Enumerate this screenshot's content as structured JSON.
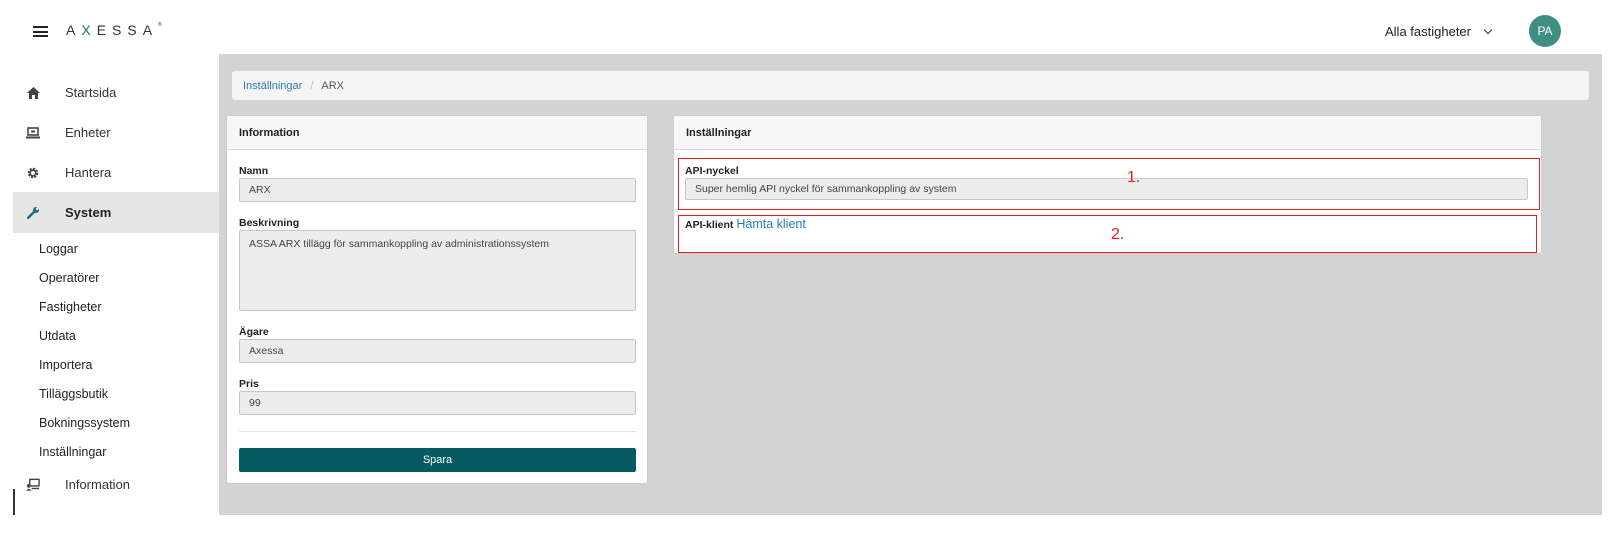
{
  "header": {
    "logo": {
      "pre": "A",
      "x": "X",
      "post": "ESSA",
      "mark": "®"
    },
    "property_select": "Alla fastigheter",
    "avatar_initials": "PA",
    "accent": "#3e8e83"
  },
  "sidebar": {
    "main_items": [
      {
        "label": "Startsida",
        "icon": "home-icon"
      },
      {
        "label": "Enheter",
        "icon": "laptop-icon"
      },
      {
        "label": "Hantera",
        "icon": "gear-icon"
      },
      {
        "label": "System",
        "icon": "wrench-icon",
        "active": true
      }
    ],
    "sub_items": [
      "Loggar",
      "Operatörer",
      "Fastigheter",
      "Utdata",
      "Importera",
      "Tilläggsbutik",
      "Bokningssystem",
      "Inställningar"
    ],
    "info_item": {
      "label": "Information",
      "icon": "user-desk-icon"
    }
  },
  "breadcrumb": {
    "parent": "Inställningar",
    "current": "ARX"
  },
  "info_panel": {
    "title": "Information",
    "name_label": "Namn",
    "name_value": "ARX",
    "desc_label": "Beskrivning",
    "desc_value": "ASSA ARX tillägg för sammankoppling av administrationssystem",
    "owner_label": "Ägare",
    "owner_value": "Axessa",
    "price_label": "Pris",
    "price_value": "99",
    "save_label": "Spara",
    "save_color": "#075a62"
  },
  "settings_panel": {
    "title": "Inställningar",
    "api_key_label": "API-nyckel",
    "api_key_value": "Super hemlig API nyckel för sammankoppling av system",
    "api_client_label": "API-klient",
    "api_client_link": "Hämta klient",
    "marker_1": "1.",
    "marker_2": "2.",
    "highlight_color": "#e02020"
  }
}
